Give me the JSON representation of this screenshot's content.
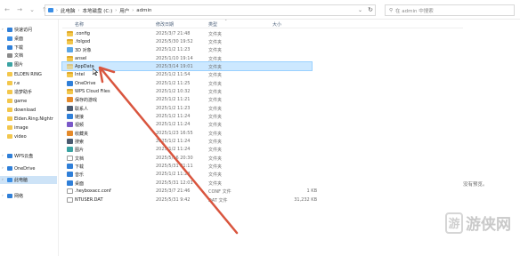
{
  "address_bar": {
    "crumbs": [
      "此电脑",
      "本地磁盘 (C:)",
      "用户",
      "admin"
    ],
    "search_placeholder": "在 admin 中搜索"
  },
  "nav": {
    "items": [
      {
        "label": "快速访问",
        "icon": "star-icon",
        "color": "#2f7fd8"
      },
      {
        "label": "桌面",
        "icon": "desktop-icon",
        "color": "#3a8ee6"
      },
      {
        "label": "下载",
        "icon": "download-icon",
        "color": "#2f7fd8"
      },
      {
        "label": "文档",
        "icon": "document-icon",
        "color": "#8a8a8a"
      },
      {
        "label": "图片",
        "icon": "picture-icon",
        "color": "#3aa3a3"
      },
      {
        "label": "ELDEN RING",
        "icon": "folder-icon",
        "color": "#f3c74c"
      },
      {
        "label": "r.e",
        "icon": "folder-icon",
        "color": "#f3c74c"
      },
      {
        "label": "造梦助手",
        "icon": "folder-icon",
        "color": "#f3c74c"
      },
      {
        "label": "game",
        "icon": "folder-icon",
        "color": "#f3c74c"
      },
      {
        "label": "download",
        "icon": "folder-icon",
        "color": "#f3c74c"
      },
      {
        "label": "Elden.Ring.Nightr",
        "icon": "folder-icon",
        "color": "#f3c74c"
      },
      {
        "label": "image",
        "icon": "folder-icon",
        "color": "#f3c74c"
      },
      {
        "label": "video",
        "icon": "folder-icon",
        "color": "#f3c74c"
      },
      {
        "label": "WPS云盘",
        "icon": "cloud-icon",
        "color": "#2f7fd8"
      },
      {
        "label": "OneDrive",
        "icon": "cloud-icon",
        "color": "#2f7fd8"
      },
      {
        "label": "此电脑",
        "icon": "computer-icon",
        "color": "#3a8ee6"
      },
      {
        "label": "网络",
        "icon": "network-icon",
        "color": "#2f7fd8"
      }
    ]
  },
  "columns": {
    "name": "名称",
    "date": "修改日期",
    "type": "类型",
    "size": "大小"
  },
  "files": [
    {
      "name": ".config",
      "date": "2025/3/7 21:48",
      "type": "文件夹",
      "size": "",
      "icon": "folder"
    },
    {
      "name": ".folgod",
      "date": "2025/5/30 19:52",
      "type": "文件夹",
      "size": "",
      "icon": "folder"
    },
    {
      "name": "3D 对象",
      "date": "2025/1/2 11:23",
      "type": "文件夹",
      "size": "",
      "icon": "obj3d"
    },
    {
      "name": "ansel",
      "date": "2025/1/10 19:14",
      "type": "文件夹",
      "size": "",
      "icon": "folder"
    },
    {
      "name": "AppData",
      "date": "2025/3/14 19:01",
      "type": "文件夹",
      "size": "",
      "icon": "folder faded"
    },
    {
      "name": "Intel",
      "date": "2025/1/2 11:54",
      "type": "文件夹",
      "size": "",
      "icon": "folder"
    },
    {
      "name": "OneDrive",
      "date": "2025/1/2 11:25",
      "type": "文件夹",
      "size": "",
      "icon": "blue"
    },
    {
      "name": "WPS Cloud Files",
      "date": "2025/1/2 10:32",
      "type": "文件夹",
      "size": "",
      "icon": "folder"
    },
    {
      "name": "保存的游戏",
      "date": "2025/1/2 11:21",
      "type": "文件夹",
      "size": "",
      "icon": "orange"
    },
    {
      "name": "联系人",
      "date": "2025/1/2 11:23",
      "type": "文件夹",
      "size": "",
      "icon": "dark"
    },
    {
      "name": "链接",
      "date": "2025/1/2 11:24",
      "type": "文件夹",
      "size": "",
      "icon": "blue"
    },
    {
      "name": "视频",
      "date": "2025/1/2 11:24",
      "type": "文件夹",
      "size": "",
      "icon": "purple"
    },
    {
      "name": "收藏夹",
      "date": "2025/1/23 16:55",
      "type": "文件夹",
      "size": "",
      "icon": "orange"
    },
    {
      "name": "搜索",
      "date": "2025/1/2 11:24",
      "type": "文件夹",
      "size": "",
      "icon": "dark"
    },
    {
      "name": "图片",
      "date": "2025/1/2 11:24",
      "type": "文件夹",
      "size": "",
      "icon": "teal"
    },
    {
      "name": "文档",
      "date": "2025/5/16 20:30",
      "type": "文件夹",
      "size": "",
      "icon": "doc"
    },
    {
      "name": "下载",
      "date": "2025/5/31 21:11",
      "type": "文件夹",
      "size": "",
      "icon": "blue"
    },
    {
      "name": "音乐",
      "date": "2025/1/2 11:24",
      "type": "文件夹",
      "size": "",
      "icon": "blue"
    },
    {
      "name": "桌面",
      "date": "2025/5/31 12:01",
      "type": "文件夹",
      "size": "",
      "icon": "blue"
    },
    {
      "name": ".heyboxacc.conf",
      "date": "2025/3/7 21:46",
      "type": "CONF 文件",
      "size": "1 KB",
      "icon": "doc"
    },
    {
      "name": "NTUSER.DAT",
      "date": "2025/5/31 9:42",
      "type": "DAT 文件",
      "size": "31,232 KB",
      "icon": "doc"
    }
  ],
  "preview_text": "没有预览。",
  "watermark": {
    "mark": "游",
    "text": "游侠网"
  },
  "annotation_color": "#d9553e"
}
